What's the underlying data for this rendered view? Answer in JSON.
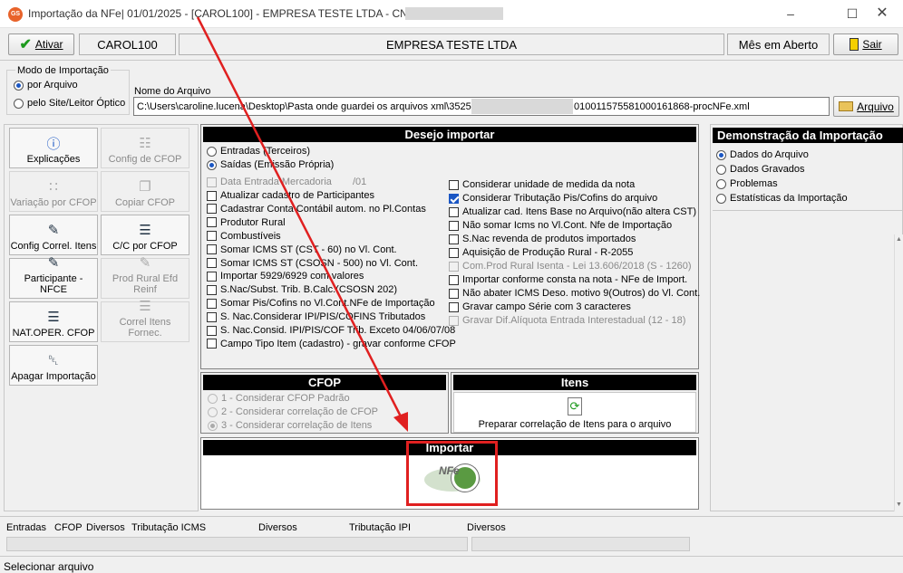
{
  "window": {
    "title": "Importação da NFe|  01/01/2025 - [CAROL100] - EMPRESA TESTE LTDA - CNPJ:",
    "app_badge": "GS"
  },
  "toolbar": {
    "activate_label": "Ativar",
    "user": "CAROL100",
    "company": "EMPRESA TESTE LTDA",
    "month_status": "Mês em Aberto",
    "exit_label": "Sair"
  },
  "import_mode": {
    "legend": "Modo de Importação",
    "options": [
      {
        "label": "por Arquivo",
        "selected": true
      },
      {
        "label": "pelo Site/Leitor Óptico",
        "selected": false
      }
    ]
  },
  "file": {
    "label": "Nome do Arquivo",
    "path_prefix": "C:\\Users\\caroline.lucena\\Desktop\\Pasta onde guardei os arquivos xml\\3525",
    "path_suffix": "010011575581000161868-procNFe.xml",
    "button_label": "Arquivo"
  },
  "sidebar": [
    {
      "label": "Explicações",
      "icon": "info-icon",
      "enabled": true
    },
    {
      "label": "Config de CFOP",
      "icon": "hierarchy-icon",
      "enabled": false
    },
    {
      "label": "Variação por CFOP",
      "icon": "grid-icon",
      "enabled": false
    },
    {
      "label": "Copiar CFOP",
      "icon": "copy-icon",
      "enabled": false
    },
    {
      "label": "Config Correl. Itens",
      "icon": "notepad-edit-icon",
      "enabled": true
    },
    {
      "label": "C/C por CFOP",
      "icon": "list-icon",
      "enabled": true
    },
    {
      "label": "Participante - NFCE",
      "icon": "notepad-edit-icon",
      "enabled": true
    },
    {
      "label": "Prod Rural Efd Reinf",
      "icon": "notepad-edit-icon",
      "enabled": false
    },
    {
      "label": "NAT.OPER. CFOP",
      "icon": "list-icon",
      "enabled": true
    },
    {
      "label": "Correl Itens Fornec.",
      "icon": "list-icon",
      "enabled": false
    },
    {
      "label": "Apagar Importação",
      "icon": "trash-icon",
      "enabled": true
    }
  ],
  "desejo": {
    "header": "Desejo importar",
    "radios": [
      {
        "label": "Entradas (Terceiros)",
        "selected": false
      },
      {
        "label": "Saídas (Emissão Própria)",
        "selected": true
      }
    ],
    "date_label": "Data Entrada Mercadoria",
    "date_value": "/01",
    "left_checks": [
      {
        "label": "Atualizar cadastro de Participantes",
        "checked": false
      },
      {
        "label": "Cadastrar Conta Contábil autom. no Pl.Contas",
        "checked": false
      },
      {
        "label": "Produtor Rural",
        "checked": false
      },
      {
        "label": "Combustíveis",
        "checked": false
      },
      {
        "label": "Somar ICMS ST (CST - 60) no Vl. Cont.",
        "checked": false
      },
      {
        "label": "Somar ICMS ST (CSOSN - 500) no Vl. Cont.",
        "checked": false
      },
      {
        "label": "Importar 5929/6929 com valores",
        "checked": false
      },
      {
        "label": "S.Nac/Subst. Trib. B.Calc.(CSOSN 202)",
        "checked": false
      },
      {
        "label": "Somar Pis/Cofins no Vl.Cont.NFe de Importação",
        "checked": false
      },
      {
        "label": "S. Nac.Considerar IPI/PIS/COFINS Tributados",
        "checked": false
      },
      {
        "label": "S. Nac.Consid. IPI/PIS/COF Trib. Exceto 04/06/07/08",
        "checked": false
      },
      {
        "label": "Campo Tipo Item (cadastro) - gravar conforme CFOP",
        "checked": false
      }
    ],
    "right_checks": [
      {
        "label": "Considerar unidade de medida da nota",
        "checked": false,
        "enabled": true
      },
      {
        "label": "Considerar Tributação Pis/Cofins do arquivo",
        "checked": true,
        "enabled": true
      },
      {
        "label": "Atualizar cad. Itens Base no Arquivo(não altera CST)",
        "checked": false,
        "enabled": true
      },
      {
        "label": "Não somar Icms no Vl.Cont. Nfe de Importação",
        "checked": false,
        "enabled": true
      },
      {
        "label": "S.Nac revenda de produtos importados",
        "checked": false,
        "enabled": true
      },
      {
        "label": "Aquisição de Produção Rural - R-2055",
        "checked": false,
        "enabled": true
      },
      {
        "label": "Com.Prod Rural Isenta - Lei 13.606/2018 (S - 1260)",
        "checked": false,
        "enabled": false
      },
      {
        "label": "Importar conforme consta na nota - NFe de Import.",
        "checked": false,
        "enabled": true
      },
      {
        "label": "Não abater ICMS Deso. motivo 9(Outros) do Vl. Cont.",
        "checked": false,
        "enabled": true
      },
      {
        "label": "Gravar campo Série com 3 caracteres",
        "checked": false,
        "enabled": true
      },
      {
        "label": "Gravar Dif.Alíquota Entrada Interestadual (12 - 18)",
        "checked": false,
        "enabled": false
      }
    ]
  },
  "cfop": {
    "header": "CFOP",
    "options": [
      {
        "label": "1 - Considerar CFOP Padrão",
        "selected": false
      },
      {
        "label": "2 - Considerar correlação de CFOP",
        "selected": false
      },
      {
        "label": "3 - Considerar correlação de Itens",
        "selected": true
      }
    ]
  },
  "itens": {
    "header": "Itens",
    "button_label": "Preparar correlação de Itens para o arquivo"
  },
  "importar": {
    "header": "Importar",
    "logo_text": "NFe"
  },
  "demo": {
    "header": "Demonstração da Importação",
    "options": [
      {
        "label": "Dados do Arquivo",
        "selected": true
      },
      {
        "label": "Dados Gravados",
        "selected": false
      },
      {
        "label": "Problemas",
        "selected": false
      },
      {
        "label": "Estatísticas da Importação",
        "selected": false
      }
    ]
  },
  "bottom_tabs": [
    "Entradas",
    "CFOP",
    "Diversos",
    "Tributação ICMS",
    "Diversos",
    "Tributação IPI",
    "Diversos"
  ],
  "status": "Selecionar arquivo",
  "colors": {
    "annotation": "#e02020",
    "radio_selected": "#1a56c4"
  }
}
